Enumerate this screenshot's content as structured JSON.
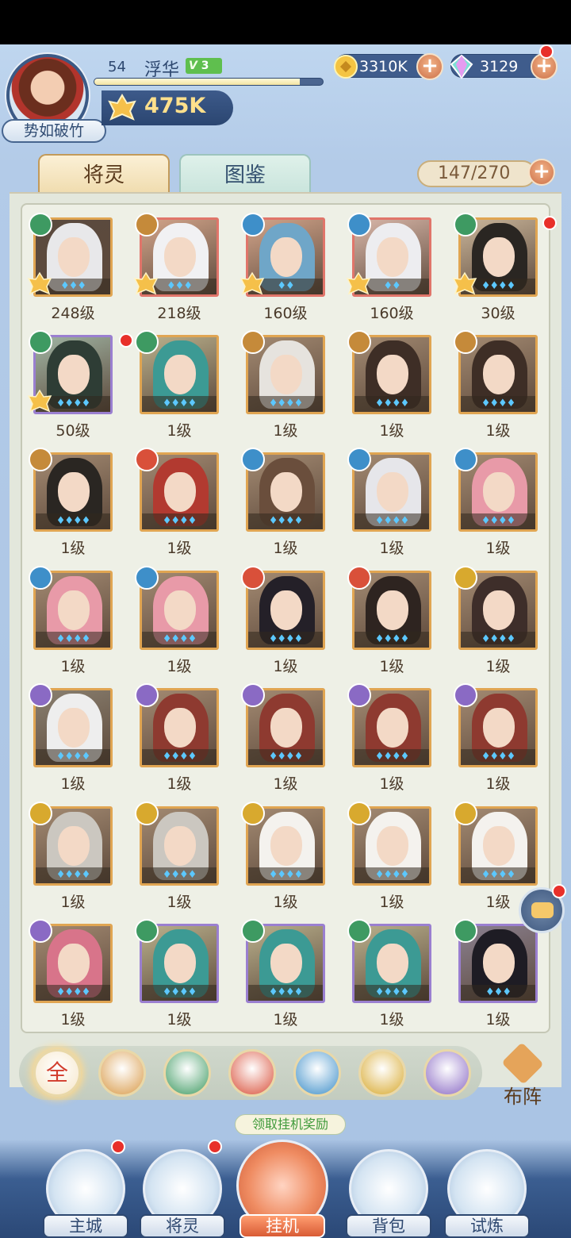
{
  "header": {
    "level": "54",
    "player_name": "浮华",
    "vip": "3",
    "rank_title": "势如破竹",
    "power": "475K",
    "exp_progress": 0.9,
    "gold": "3310K",
    "gems": "3129"
  },
  "tabs": {
    "active": "将灵",
    "inactive": "图鉴"
  },
  "collection_count": "147/270",
  "icons": {
    "plus": "+",
    "chat": "chat-bubble-icon",
    "formation": "flag-icon"
  },
  "heroes": [
    {
      "level": "248级",
      "element": "wind",
      "frame": "gold",
      "hair": "#e8e8ea",
      "skin_bg": "#5a4a3e",
      "stars": "♦♦♦",
      "badge": true
    },
    {
      "level": "218级",
      "element": "earth",
      "frame": "red",
      "hair": "#f1f1f3",
      "skin_bg": "#d2a48a",
      "stars": "♦♦♦",
      "badge": true
    },
    {
      "level": "160级",
      "element": "water",
      "frame": "red",
      "hair": "#6fa6c8",
      "skin_bg": "#d2a48a",
      "stars": "♦♦",
      "badge": true
    },
    {
      "level": "160级",
      "element": "water",
      "frame": "red",
      "hair": "#ededf0",
      "skin_bg": "#d8b6a8",
      "stars": "♦♦",
      "badge": true
    },
    {
      "level": "30级",
      "element": "wind",
      "frame": "gold",
      "hair": "#2a2622",
      "skin_bg": "#c9b59a",
      "stars": "♦♦♦♦",
      "badge": true
    },
    {
      "level": "50级",
      "element": "wind",
      "frame": "purple",
      "hair": "#2e3d35",
      "skin_bg": "#9fb4a3",
      "stars": "♦♦♦♦",
      "badge": true
    },
    {
      "level": "1级",
      "element": "wind",
      "frame": "gold",
      "hair": "#3c9a94",
      "skin_bg": "#b9b08c",
      "stars": "♦♦♦♦",
      "badge": false
    },
    {
      "level": "1级",
      "element": "earth",
      "frame": "gold",
      "hair": "#e6e3de",
      "skin_bg": "#a38a72",
      "stars": "♦♦♦♦",
      "badge": false
    },
    {
      "level": "1级",
      "element": "earth",
      "frame": "gold",
      "hair": "#3e2e26",
      "skin_bg": "#a38a72",
      "stars": "♦♦♦♦",
      "badge": false
    },
    {
      "level": "1级",
      "element": "earth",
      "frame": "gold",
      "hair": "#3e2e26",
      "skin_bg": "#a38a72",
      "stars": "♦♦♦♦",
      "badge": false
    },
    {
      "level": "1级",
      "element": "earth",
      "frame": "gold",
      "hair": "#2a2622",
      "skin_bg": "#a38a72",
      "stars": "♦♦♦♦",
      "badge": false
    },
    {
      "level": "1级",
      "element": "fire",
      "frame": "gold",
      "hair": "#b23a30",
      "skin_bg": "#a38a72",
      "stars": "♦♦♦♦",
      "badge": false
    },
    {
      "level": "1级",
      "element": "water",
      "frame": "gold",
      "hair": "#6a4e3c",
      "skin_bg": "#a38a72",
      "stars": "♦♦♦♦",
      "badge": false
    },
    {
      "level": "1级",
      "element": "water",
      "frame": "gold",
      "hair": "#e6e6ea",
      "skin_bg": "#a38a72",
      "stars": "♦♦♦♦",
      "badge": false
    },
    {
      "level": "1级",
      "element": "water",
      "frame": "gold",
      "hair": "#e89aa8",
      "skin_bg": "#a38a72",
      "stars": "♦♦♦♦",
      "badge": false
    },
    {
      "level": "1级",
      "element": "water",
      "frame": "gold",
      "hair": "#e89aa8",
      "skin_bg": "#a38a72",
      "stars": "♦♦♦♦",
      "badge": false
    },
    {
      "level": "1级",
      "element": "water",
      "frame": "gold",
      "hair": "#e89aa8",
      "skin_bg": "#a38a72",
      "stars": "♦♦♦♦",
      "badge": false
    },
    {
      "level": "1级",
      "element": "fire",
      "frame": "gold",
      "hair": "#242028",
      "skin_bg": "#a38a72",
      "stars": "♦♦♦♦",
      "badge": false
    },
    {
      "level": "1级",
      "element": "fire",
      "frame": "gold",
      "hair": "#2e2420",
      "skin_bg": "#a38a72",
      "stars": "♦♦♦♦",
      "badge": false
    },
    {
      "level": "1级",
      "element": "light",
      "frame": "gold",
      "hair": "#3e2e2a",
      "skin_bg": "#a38a72",
      "stars": "♦♦♦♦",
      "badge": false
    },
    {
      "level": "1级",
      "element": "dark",
      "frame": "gold",
      "hair": "#eeeeee",
      "skin_bg": "#8a8070",
      "stars": "♦♦♦♦",
      "badge": false
    },
    {
      "level": "1级",
      "element": "dark",
      "frame": "gold",
      "hair": "#8e3a30",
      "skin_bg": "#a38a72",
      "stars": "♦♦♦♦",
      "badge": false
    },
    {
      "level": "1级",
      "element": "dark",
      "frame": "gold",
      "hair": "#8e3a30",
      "skin_bg": "#a38a72",
      "stars": "♦♦♦♦",
      "badge": false
    },
    {
      "level": "1级",
      "element": "dark",
      "frame": "gold",
      "hair": "#8e3a30",
      "skin_bg": "#a38a72",
      "stars": "♦♦♦♦",
      "badge": false
    },
    {
      "level": "1级",
      "element": "dark",
      "frame": "gold",
      "hair": "#8e3a30",
      "skin_bg": "#a38a72",
      "stars": "♦♦♦♦",
      "badge": false
    },
    {
      "level": "1级",
      "element": "light",
      "frame": "gold",
      "hair": "#cbc7c0",
      "skin_bg": "#a38a72",
      "stars": "♦♦♦♦",
      "badge": false
    },
    {
      "level": "1级",
      "element": "light",
      "frame": "gold",
      "hair": "#cbc7c0",
      "skin_bg": "#a38a72",
      "stars": "♦♦♦♦",
      "badge": false
    },
    {
      "level": "1级",
      "element": "light",
      "frame": "gold",
      "hair": "#f4f2ee",
      "skin_bg": "#a38a72",
      "stars": "♦♦♦♦",
      "badge": false
    },
    {
      "level": "1级",
      "element": "light",
      "frame": "gold",
      "hair": "#f4f2ee",
      "skin_bg": "#a38a72",
      "stars": "♦♦♦♦",
      "badge": false
    },
    {
      "level": "1级",
      "element": "light",
      "frame": "gold",
      "hair": "#f4f2ee",
      "skin_bg": "#a38a72",
      "stars": "♦♦♦♦",
      "badge": false
    },
    {
      "level": "1级",
      "element": "dark",
      "frame": "gold",
      "hair": "#d8748a",
      "skin_bg": "#a38a72",
      "stars": "♦♦♦♦",
      "badge": false
    },
    {
      "level": "1级",
      "element": "wind",
      "frame": "purple",
      "hair": "#3c9a94",
      "skin_bg": "#b9b08c",
      "stars": "♦♦♦♦",
      "badge": false
    },
    {
      "level": "1级",
      "element": "wind",
      "frame": "purple",
      "hair": "#3c9a94",
      "skin_bg": "#b9b08c",
      "stars": "♦♦♦♦",
      "badge": false
    },
    {
      "level": "1级",
      "element": "wind",
      "frame": "purple",
      "hair": "#3c9a94",
      "skin_bg": "#b9b08c",
      "stars": "♦♦♦♦",
      "badge": false
    },
    {
      "level": "1级",
      "element": "wind",
      "frame": "purple",
      "hair": "#1e1c24",
      "skin_bg": "#8a8090",
      "stars": "♦♦♦",
      "badge": false
    }
  ],
  "element_colors": {
    "wind": "#3e9a62",
    "earth": "#c58a3a",
    "water": "#3e8fc9",
    "fire": "#d9503a",
    "light": "#d8a92e",
    "dark": "#8a6ac4"
  },
  "filters": [
    {
      "key": "all",
      "label": "全",
      "color": "#f6e6c8"
    },
    {
      "key": "earth",
      "label": "",
      "color": "#d99a48"
    },
    {
      "key": "wind",
      "label": "",
      "color": "#3e9a62"
    },
    {
      "key": "fire",
      "label": "",
      "color": "#d9503a"
    },
    {
      "key": "water",
      "label": "",
      "color": "#3e8fc9"
    },
    {
      "key": "light",
      "label": "",
      "color": "#d8a92e"
    },
    {
      "key": "dark",
      "label": "",
      "color": "#8a6ac4"
    }
  ],
  "formation_label": "布阵",
  "reward_label": "领取挂机奖励",
  "nav": [
    {
      "label": "主城"
    },
    {
      "label": "将灵"
    },
    {
      "label": "挂机"
    },
    {
      "label": "背包"
    },
    {
      "label": "试炼"
    }
  ]
}
